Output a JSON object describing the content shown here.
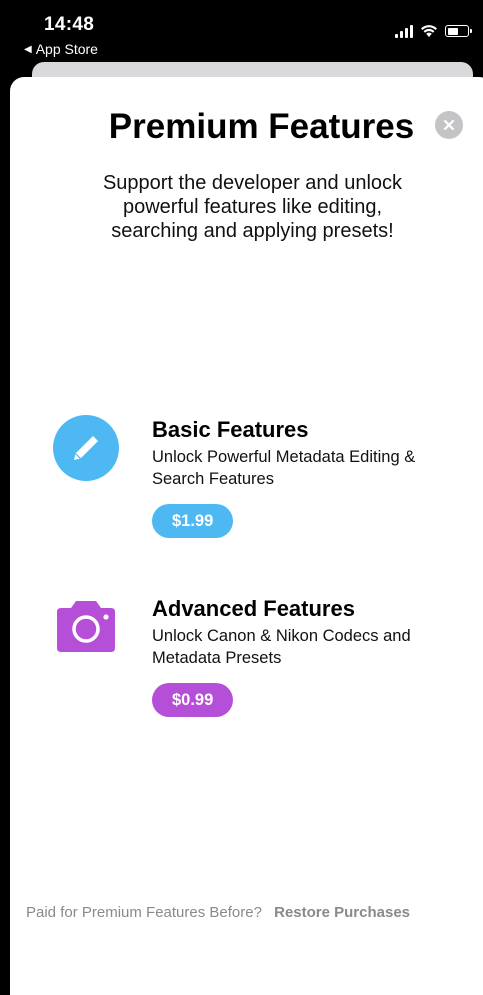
{
  "status_bar": {
    "time": "14:48",
    "back_app": "App Store",
    "battery_level": 0.55
  },
  "header": {
    "title": "Premium Features",
    "subtitle": "Support the developer and unlock powerful features like editing, searching and applying presets!"
  },
  "features": [
    {
      "name": "Basic Features",
      "description": "Unlock Powerful Metadata Editing & Search Features",
      "price": "$1.99",
      "icon": "pencil-icon",
      "color": "#4db8f2"
    },
    {
      "name": "Advanced Features",
      "description": "Unlock Canon & Nikon Codecs and Metadata Presets",
      "price": "$0.99",
      "icon": "camera-icon",
      "color": "#b64fd8"
    }
  ],
  "footer": {
    "question": "Paid for Premium Features Before?",
    "restore_label": "Restore Purchases"
  }
}
